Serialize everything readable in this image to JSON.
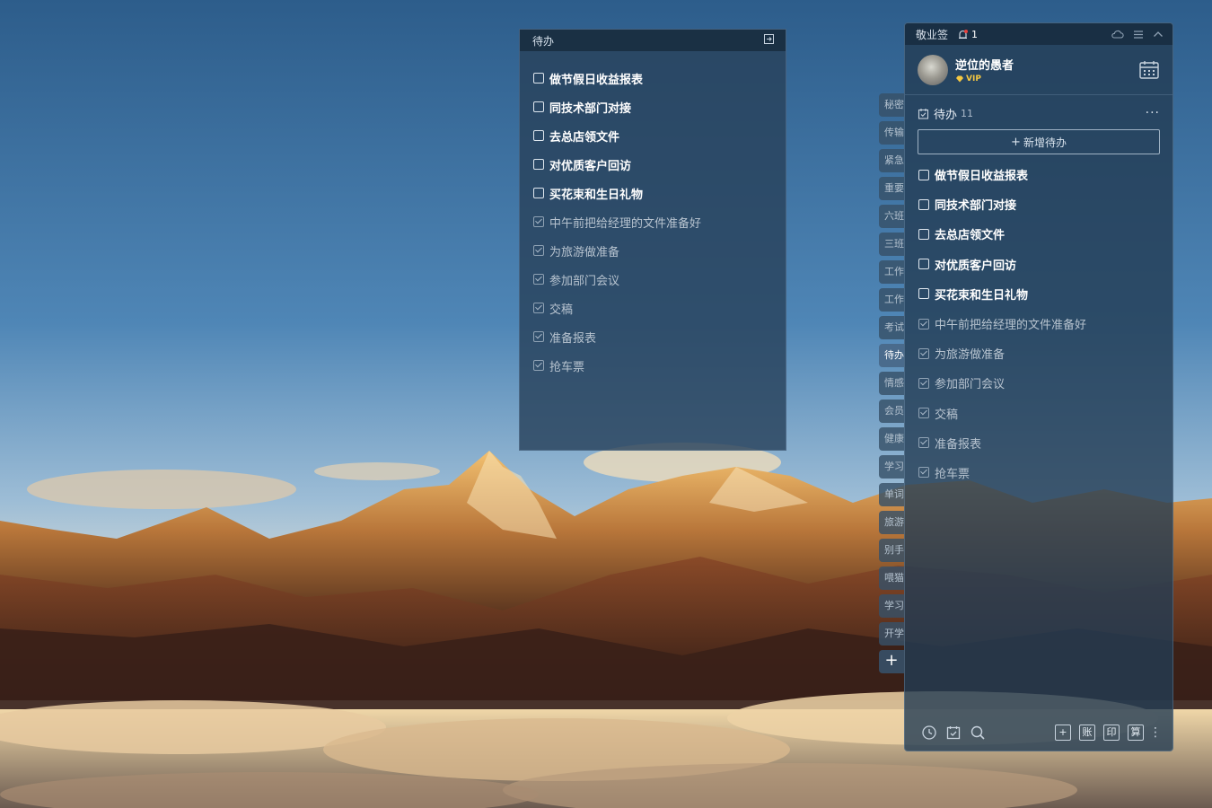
{
  "colors": {
    "sky_top": "#2f5e8c",
    "sky_bottom": "#8fb3d0",
    "panel_bg": "#233c54",
    "accent_red": "#e8413c",
    "vip_gold": "#f5c842"
  },
  "float_note": {
    "title": "待办",
    "exit_icon": "exit-icon",
    "items": [
      {
        "text": "做节假日收益报表",
        "done": false
      },
      {
        "text": "同技术部门对接",
        "done": false
      },
      {
        "text": "去总店领文件",
        "done": false
      },
      {
        "text": "对优质客户回访",
        "done": false
      },
      {
        "text": "买花束和生日礼物",
        "done": false
      },
      {
        "text": "中午前把给经理的文件准备好",
        "done": true
      },
      {
        "text": "为旅游做准备",
        "done": true
      },
      {
        "text": "参加部门会议",
        "done": true
      },
      {
        "text": "交稿",
        "done": true
      },
      {
        "text": "准备报表",
        "done": true
      },
      {
        "text": "抢车票",
        "done": true
      }
    ]
  },
  "tabs": {
    "items": [
      "秘密",
      "传输",
      "紧急",
      "重要",
      "六班",
      "三班",
      "工作",
      "工作",
      "考试",
      "待办",
      "情感",
      "会员",
      "健康",
      "学习",
      "单词",
      "旅游",
      "别手",
      "喂猫",
      "学习",
      "开学"
    ],
    "active_index": 9,
    "add_label": "+"
  },
  "panel": {
    "app_name": "敬业签",
    "notification_count": "1",
    "user": {
      "name": "逆位的愚者",
      "badge": "VIP"
    },
    "section": {
      "title": "待办",
      "count": "11",
      "more": "···"
    },
    "add_button": {
      "plus": "+",
      "label": "新增待办"
    },
    "items": [
      {
        "text": "做节假日收益报表",
        "done": false
      },
      {
        "text": "同技术部门对接",
        "done": false
      },
      {
        "text": "去总店领文件",
        "done": false
      },
      {
        "text": "对优质客户回访",
        "done": false
      },
      {
        "text": "买花束和生日礼物",
        "done": false
      },
      {
        "text": "中午前把给经理的文件准备好",
        "done": true
      },
      {
        "text": "为旅游做准备",
        "done": true
      },
      {
        "text": "参加部门会议",
        "done": true
      },
      {
        "text": "交稿",
        "done": true
      },
      {
        "text": "准备报表",
        "done": true
      },
      {
        "text": "抢车票",
        "done": true
      }
    ],
    "bottom": {
      "left_icons": [
        "clock-icon",
        "checklist-icon",
        "search-icon"
      ],
      "buttons": [
        "+",
        "账",
        "印",
        "算"
      ],
      "more": "⋮"
    }
  }
}
